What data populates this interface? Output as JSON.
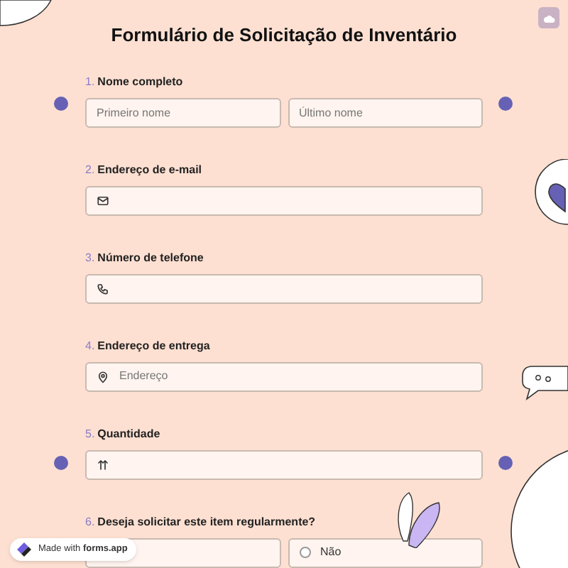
{
  "title": "Formulário de Solicitação de Inventário",
  "questions": [
    {
      "number": "1.",
      "label": "Nome completo",
      "kind": "name",
      "placeholders": [
        "Primeiro nome",
        "Último nome"
      ]
    },
    {
      "number": "2.",
      "label": "Endereço de e-mail",
      "kind": "email"
    },
    {
      "number": "3.",
      "label": "Número de telefone",
      "kind": "phone"
    },
    {
      "number": "4.",
      "label": "Endereço de entrega",
      "kind": "address",
      "placeholder": "Endereço"
    },
    {
      "number": "5.",
      "label": "Quantidade",
      "kind": "number"
    },
    {
      "number": "6.",
      "label": "Deseja solicitar este item regularmente?",
      "kind": "choice",
      "covered_first_option": true,
      "options": [
        {
          "label": "Não",
          "selected": false
        }
      ]
    }
  ],
  "badge": {
    "prefix": "Made with",
    "brand": "forms.app"
  }
}
